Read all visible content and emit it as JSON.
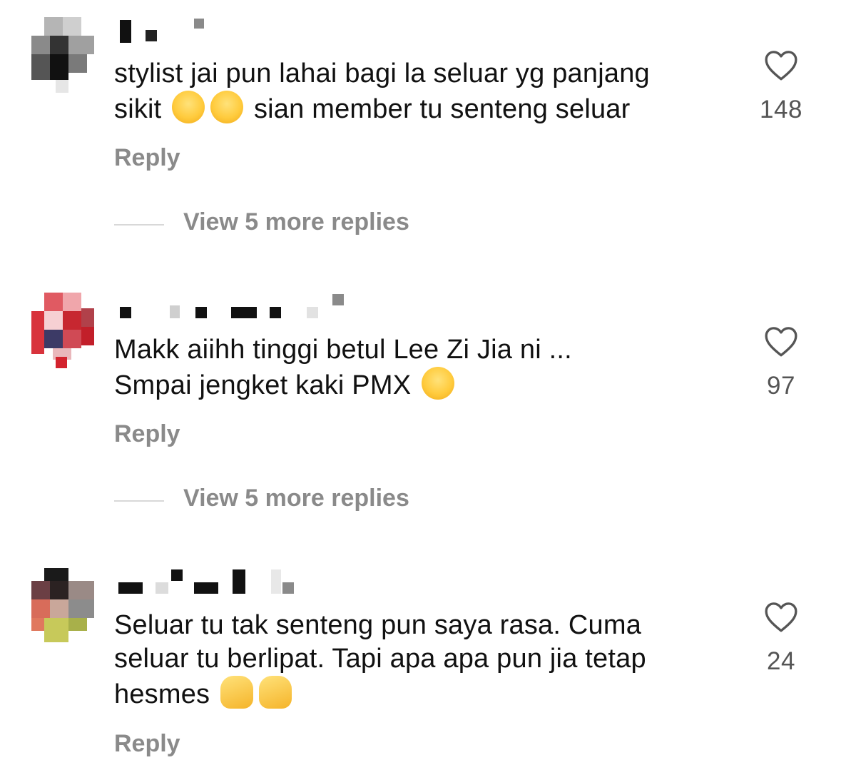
{
  "comments": [
    {
      "text_before": "stylist jai pun lahai bagi la seluar yg panjang\nsikit ",
      "emojis": [
        "😭",
        "😭"
      ],
      "text_after": " sian member tu senteng seluar",
      "reply_label": "Reply",
      "likes": "148",
      "more_replies": "View 5 more replies"
    },
    {
      "text_before": "Makk aiihh tinggi betul Lee Zi Jia ni ...\nSmpai jengket kaki PMX ",
      "emojis": [
        "😅"
      ],
      "text_after": "",
      "reply_label": "Reply",
      "likes": "97",
      "more_replies": "View 5 more replies"
    },
    {
      "text_before": "Seluar tu tak senteng pun saya rasa. Cuma\nseluar tu berlipat. Tapi apa apa pun jia tetap\nhesmes ",
      "emojis": [
        "👍",
        "👍"
      ],
      "text_after": "",
      "reply_label": "Reply",
      "likes": "24"
    }
  ],
  "icons": {
    "like": "heart-outline-icon"
  },
  "colors": {
    "muted": "#8a8a8a",
    "text": "#111111",
    "line": "#d8d8d8"
  }
}
